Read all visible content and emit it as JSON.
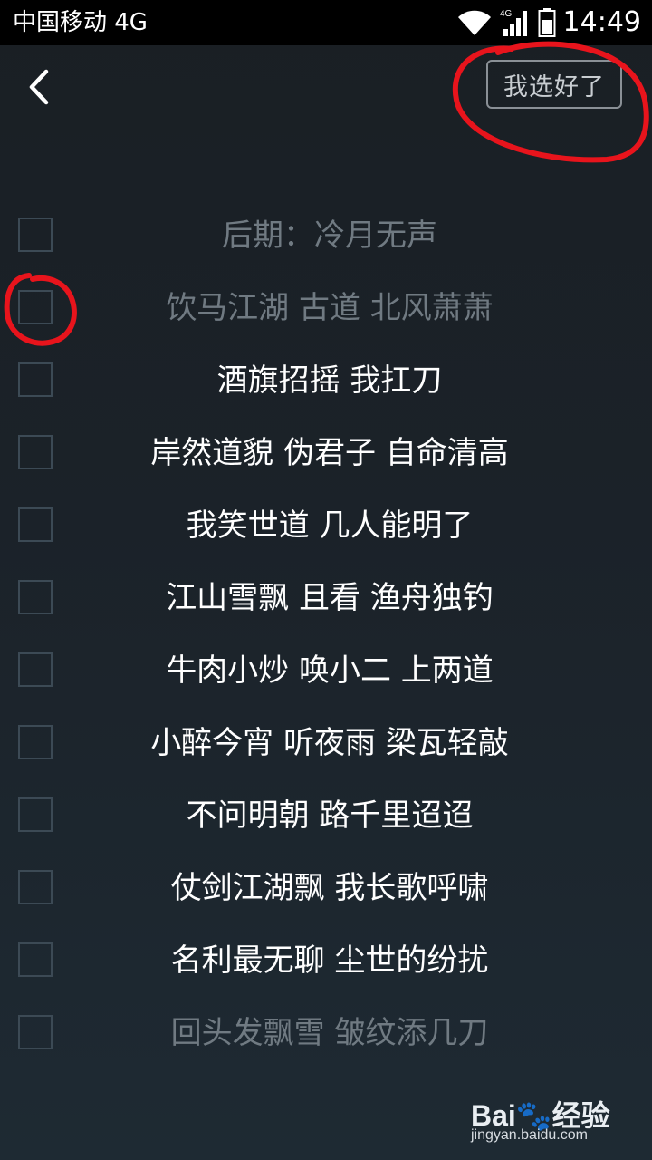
{
  "status_bar": {
    "carrier": "中国移动 4G",
    "network_label": "4G",
    "time": "14:49"
  },
  "header": {
    "back_icon": "chevron-left-icon",
    "confirm_label": "我选好了"
  },
  "lyrics": [
    {
      "text": "后期：冷月无声",
      "style": "dim",
      "checked": false
    },
    {
      "text": "饮马江湖 古道 北风萧萧",
      "style": "dim",
      "checked": false
    },
    {
      "text": "酒旗招摇 我扛刀",
      "style": "normal",
      "checked": false
    },
    {
      "text": "岸然道貌 伪君子 自命清高",
      "style": "normal",
      "checked": false
    },
    {
      "text": "我笑世道 几人能明了",
      "style": "normal",
      "checked": false
    },
    {
      "text": "江山雪飘 且看 渔舟独钓",
      "style": "normal",
      "checked": false
    },
    {
      "text": "牛肉小炒 唤小二 上两道",
      "style": "normal",
      "checked": false
    },
    {
      "text": "小醉今宵 听夜雨 梁瓦轻敲",
      "style": "normal",
      "checked": false
    },
    {
      "text": "不问明朝 路千里迢迢",
      "style": "normal",
      "checked": false
    },
    {
      "text": "仗剑江湖飘 我长歌呼啸",
      "style": "normal",
      "checked": false
    },
    {
      "text": "名利最无聊 尘世的纷扰",
      "style": "normal",
      "checked": false
    },
    {
      "text": "回头发飘雪 皱纹添几刀",
      "style": "dim",
      "checked": false
    }
  ],
  "watermark": {
    "logo": "Bai🐾经验",
    "url": "jingyan.baidu.com"
  },
  "colors": {
    "annotation_red": "#e8141c",
    "checkbox_border": "#3c4a55",
    "dim_text": "#707a82"
  }
}
